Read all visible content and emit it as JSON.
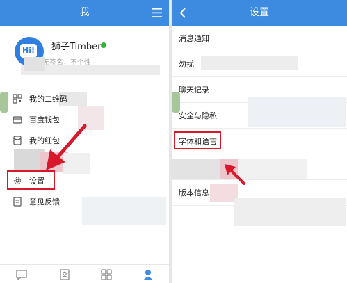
{
  "left": {
    "header": {
      "title": "我"
    },
    "profile": {
      "name": "狮子Timber",
      "signature": "无签名，不个性",
      "avatar_text": "Hi!"
    },
    "menu": [
      {
        "label": "我的二维码"
      },
      {
        "label": "百度钱包"
      },
      {
        "label": "我的红包"
      },
      {
        "label": "设置"
      },
      {
        "label": "意见反馈"
      }
    ],
    "tabs": [
      "chat-tab-icon",
      "contacts-tab-icon",
      "apps-tab-icon",
      "me-tab-icon"
    ]
  },
  "right": {
    "header": {
      "title": "设置"
    },
    "rows": [
      {
        "label": "消息通知"
      },
      {
        "label": "勿扰"
      },
      {
        "label": "聊天记录"
      },
      {
        "label": "安全与隐私"
      },
      {
        "label": "字体和语言"
      },
      {
        "label": ""
      },
      {
        "label": "版本信息"
      }
    ]
  },
  "colors": {
    "header_bg": "#3d8be0",
    "highlight": "#d8192c",
    "online": "#35b53a"
  }
}
